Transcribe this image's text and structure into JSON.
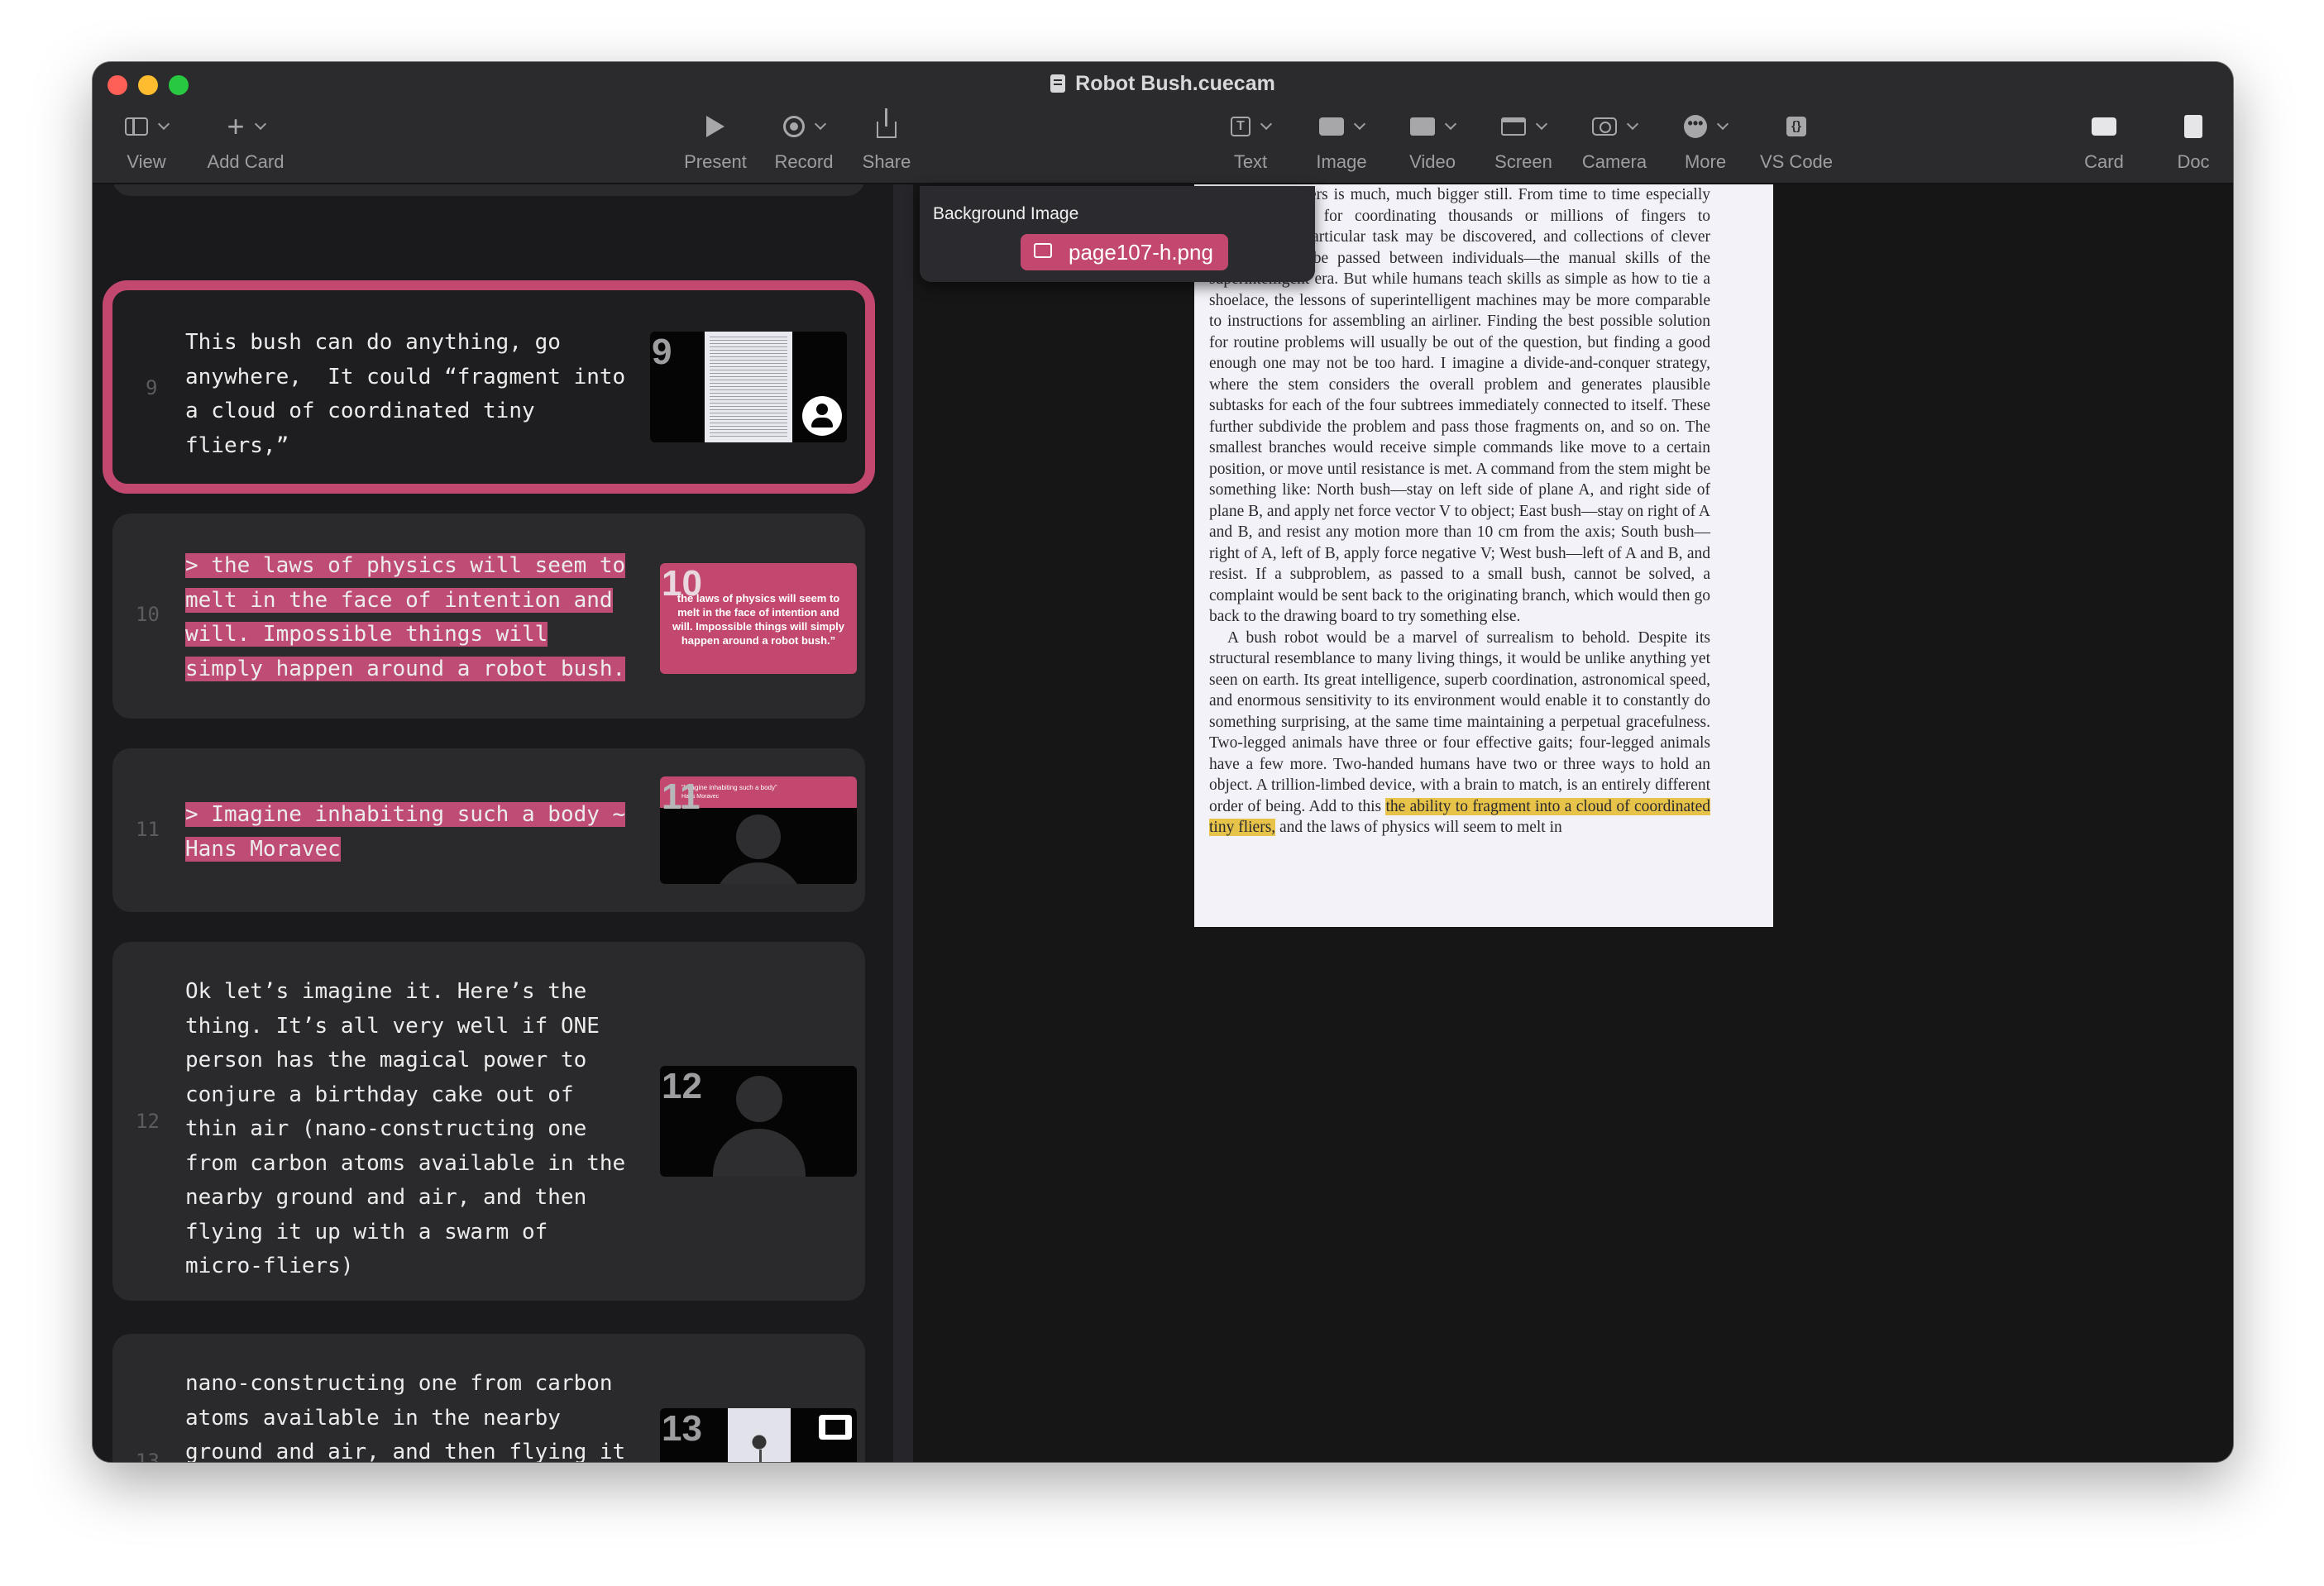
{
  "window": {
    "title": "Robot Bush.cuecam"
  },
  "toolbar": {
    "view": "View",
    "add_card": "Add Card",
    "present": "Present",
    "record": "Record",
    "share": "Share",
    "text": "Text",
    "image": "Image",
    "video": "Video",
    "screen": "Screen",
    "camera": "Camera",
    "more": "More",
    "vscode": "VS Code",
    "card": "Card",
    "doc": "Doc"
  },
  "cards": [
    {
      "number": "9",
      "text": "This bush can do anything, go\nanywhere,  It could “fragment into\na cloud of coordinated tiny\nfliers,”",
      "thumb_number": "9"
    },
    {
      "number": "10",
      "text": "> the laws of physics will seem to\nmelt in the face of intention and\nwill. Impossible things will\nsimply happen around a robot bush.",
      "thumb_number": "10",
      "thumb_text": "the laws of physics will seem to melt in the face of intention and will. Impossible things will simply happen around a robot bush.”"
    },
    {
      "number": "11",
      "text": "> Imagine inhabiting such a body ~\nHans Moravec",
      "thumb_number": "11",
      "thumb_text": "“Imagine inhabiting such a body”",
      "thumb_subtext": "Hans Moravec"
    },
    {
      "number": "12",
      "text": "Ok let’s imagine it. Here’s the\nthing. It’s all very well if ONE\nperson has the magical power to\nconjure a birthday cake out of\nthin air (nano-constructing one\nfrom carbon atoms available in the\nnearby ground and air, and then\nflying it up with a swarm of\nmicro-fliers)",
      "thumb_number": "12"
    },
    {
      "number": "13",
      "text": "nano-constructing one from carbon\natoms available in the nearby\nground and air, and then flying it\nup with a swarm of micro-fliers)\n(wait) but what if we could ALL do",
      "thumb_number": "13"
    }
  ],
  "editor": {
    "bg_label": "Background Image",
    "bg_file": "page107-h.png",
    "page_text_1": "number of fingers is much, much bigger still. From time to time especially clever strategy for coordinating thousands or millions of fingers to accomplish a particular task may be discovered, and collections of clever strategies will be passed between individuals—the manual skills of the superintelligent era. But while humans teach skills as simple as how to tie a shoelace, the lessons of superintelligent machines may be more comparable to instructions for assembling an airliner. Finding the best possible solution for routine problems will usually be out of the question, but finding a good enough one may not be too hard. I imagine a divide-and-conquer strategy, where the stem considers the overall problem and generates plausible subtasks for each of the four subtrees immediately connected to itself. These further subdivide the problem and pass those fragments on, and so on. The smallest branches would receive simple commands like move to a certain position, or move until resistance is met. A command from the stem might be something like: North bush—stay on left side of plane A, and right side of plane B, and apply net force vector V to object; East bush—stay on right of A and B, and resist any motion more than 10 cm from the axis; South bush—right of A, left of B, apply force negative V; West bush—left of A and B, and resist. If a subproblem, as passed to a small bush, cannot be solved, a complaint would be sent back to the originating branch, which would then go back to the drawing board to try something else.",
    "page_text_2": "A bush robot would be a marvel of surrealism to behold. Despite its structural resemblance to many living things, it would be unlike anything yet seen on earth. Its great intelligence, superb coordination, astronomical speed, and enormous sensitivity to its environment would enable it to constantly do something surprising, at the same time maintaining a perpetual gracefulness. Two-legged animals have three or four effective gaits; four-legged animals have a few more. Two-handed humans have two or three ways to hold an object. A trillion-limbed device, with a brain to match, is an entirely different order of being. Add to this",
    "page_highlight": "the ability to fragment into a cloud of coordinated tiny fliers,",
    "page_text_3": "and the laws of physics will seem to melt in"
  },
  "colors": {
    "accent": "#c2486f",
    "highlight": "#e7c34a",
    "window_bg": "#1c1c1e",
    "card_bg": "#2a2a2c"
  }
}
